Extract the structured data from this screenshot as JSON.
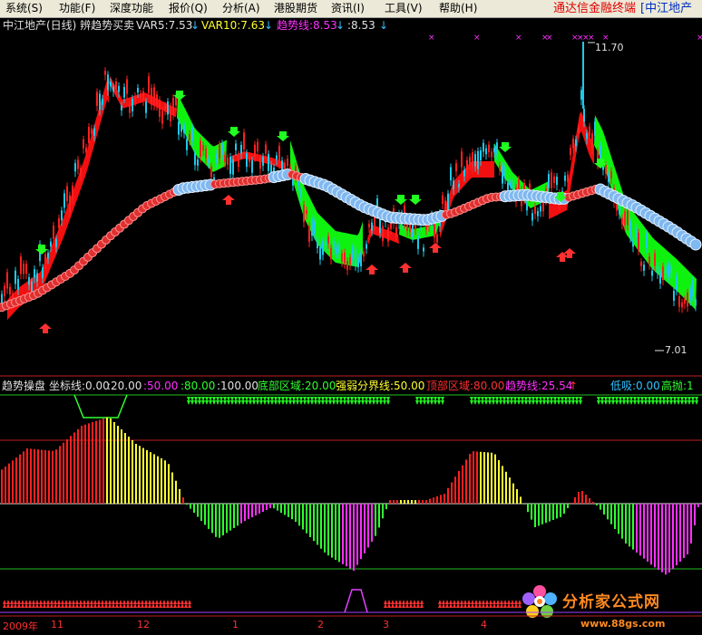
{
  "menu": {
    "items": [
      "系统(S)",
      "功能(F)",
      "深度功能",
      "报价(Q)",
      "分析(A)",
      "港股期货",
      "资讯(I)",
      "工具(V)",
      "帮助(H)"
    ],
    "app_title": "通达信金融终端",
    "stock_tag": "[中江地产"
  },
  "main_chart": {
    "header": {
      "title": "中江地产(日线) 辨趋势买卖",
      "var5": "VAR5:7.53",
      "var10": "VAR10:7.63",
      "trend": "趋势线:8.53",
      "trend2": ":8.53"
    },
    "high_label": "11.70",
    "low_label": "7.01"
  },
  "indicator": {
    "header": {
      "name": "趋势操盘",
      "coord": "坐标线:0.00",
      "c20": ":20.00",
      "c50": ":50.00",
      "c80": ":80.00",
      "c100": ":100.00",
      "bottom_zone": "底部区域:20.00",
      "strength": "强弱分界线:50.00",
      "top_zone": "顶部区域:80.00",
      "trend": "趋势线:25.54",
      "low_buy": "低吸:0.00",
      "high_sell": "高抛:1"
    }
  },
  "date_axis": {
    "labels": [
      "2009年",
      "11",
      "12",
      "1",
      "2",
      "3",
      "4"
    ]
  },
  "watermark": {
    "text": "分析家公式网",
    "url": "www.88gs.com"
  },
  "colors": {
    "up": "#ff2020",
    "down": "#20c8e8",
    "bull_band": "#ff1010",
    "bear_band": "#10ff10",
    "dot_red": "#e03030",
    "dot_blue": "#80b8f0",
    "magenta": "#ff30ff",
    "yellow": "#ffff30",
    "green": "#30ff30"
  }
}
